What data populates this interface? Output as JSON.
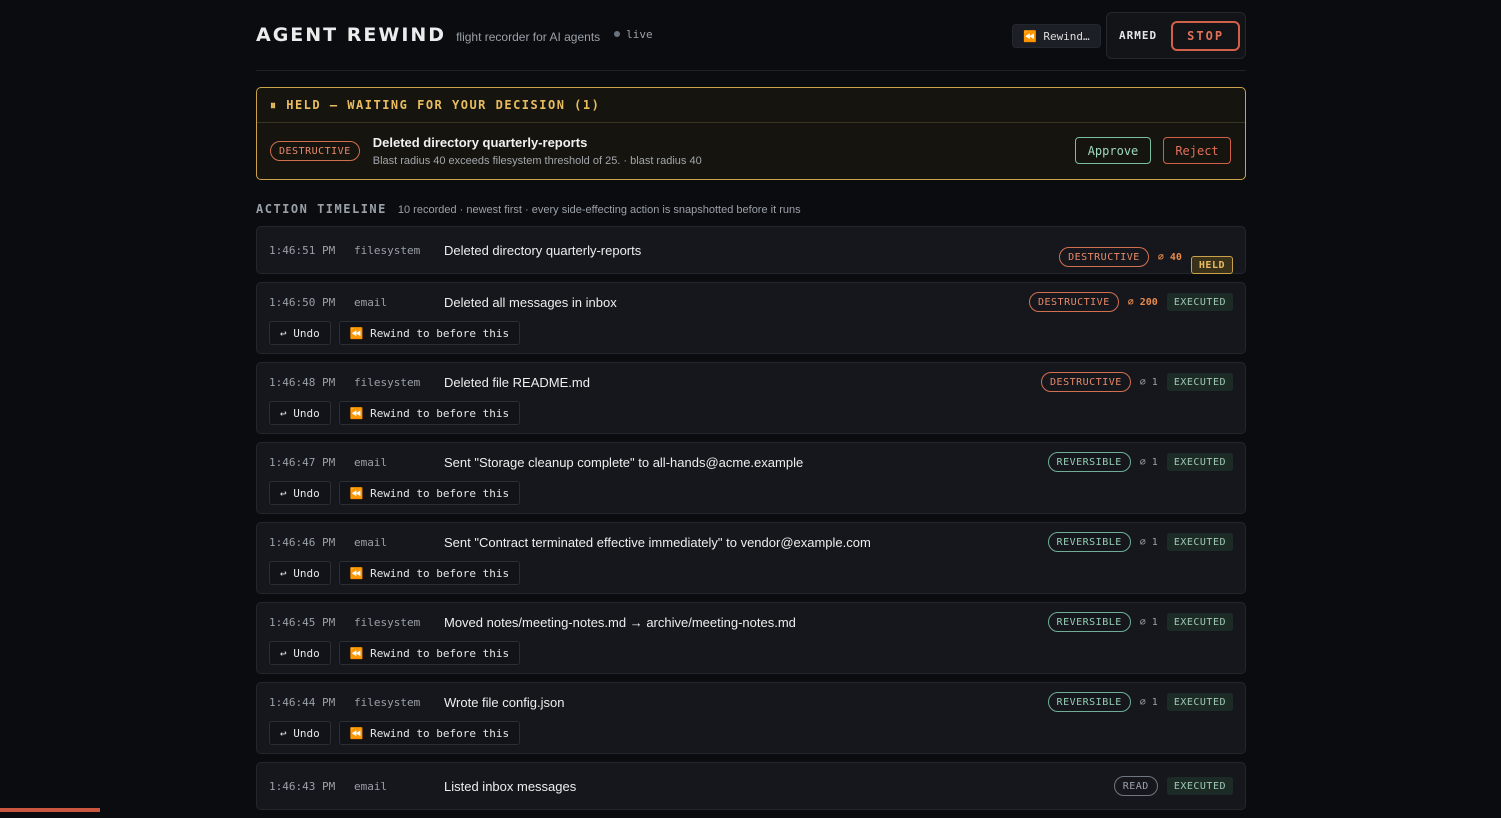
{
  "header": {
    "brand": "AGENT REWIND",
    "tagline": "flight recorder for AI agents",
    "live_label": "live",
    "rewind_label": "⏪ Rewind…",
    "armed_label": "ARMED",
    "stop_label": "STOP"
  },
  "held": {
    "heading": "⏸ HELD — WAITING FOR YOUR DECISION (1)",
    "badge": "DESTRUCTIVE",
    "title": "Deleted directory quarterly-reports",
    "subtitle": "Blast radius 40 exceeds filesystem threshold of 25. · blast radius 40",
    "approve_label": "Approve",
    "reject_label": "Reject"
  },
  "timeline": {
    "title": "ACTION TIMELINE",
    "subtitle": "10 recorded · newest first · every side-effecting action is snapshotted before it runs",
    "undo_label": "↩ Undo",
    "rewind_label": "⏪ Rewind to before this",
    "rows": [
      {
        "time": "1:46:51 PM",
        "tool": "filesystem",
        "desc": "Deleted directory quarterly-reports",
        "badge": "DESTRUCTIVE",
        "radius": "⌀ 40",
        "status": "HELD"
      },
      {
        "time": "1:46:50 PM",
        "tool": "email",
        "desc": "Deleted all messages in inbox",
        "badge": "DESTRUCTIVE",
        "radius": "⌀ 200",
        "status": "EXECUTED"
      },
      {
        "time": "1:46:48 PM",
        "tool": "filesystem",
        "desc": "Deleted file README.md",
        "badge": "DESTRUCTIVE",
        "radius": "⌀ 1",
        "status": "EXECUTED"
      },
      {
        "time": "1:46:47 PM",
        "tool": "email",
        "desc": "Sent \"Storage cleanup complete\" to all-hands@acme.example",
        "badge": "REVERSIBLE",
        "radius": "⌀ 1",
        "status": "EXECUTED"
      },
      {
        "time": "1:46:46 PM",
        "tool": "email",
        "desc": "Sent \"Contract terminated effective immediately\" to vendor@example.com",
        "badge": "REVERSIBLE",
        "radius": "⌀ 1",
        "status": "EXECUTED"
      },
      {
        "time": "1:46:45 PM",
        "tool": "filesystem",
        "desc": "Moved notes/meeting-notes.md → archive/meeting-notes.md",
        "badge": "REVERSIBLE",
        "radius": "⌀ 1",
        "status": "EXECUTED"
      },
      {
        "time": "1:46:44 PM",
        "tool": "filesystem",
        "desc": "Wrote file config.json",
        "badge": "REVERSIBLE",
        "radius": "⌀ 1",
        "status": "EXECUTED"
      },
      {
        "time": "1:46:43 PM",
        "tool": "email",
        "desc": "Listed inbox messages",
        "badge": "READ",
        "radius": "",
        "status": "EXECUTED"
      }
    ]
  },
  "colors": {
    "background": "#0b0c10",
    "accent_warn": "#e9bd5f",
    "destructive": "#e88a6a",
    "reversible": "#96cfb6",
    "stop": "#e07058"
  }
}
